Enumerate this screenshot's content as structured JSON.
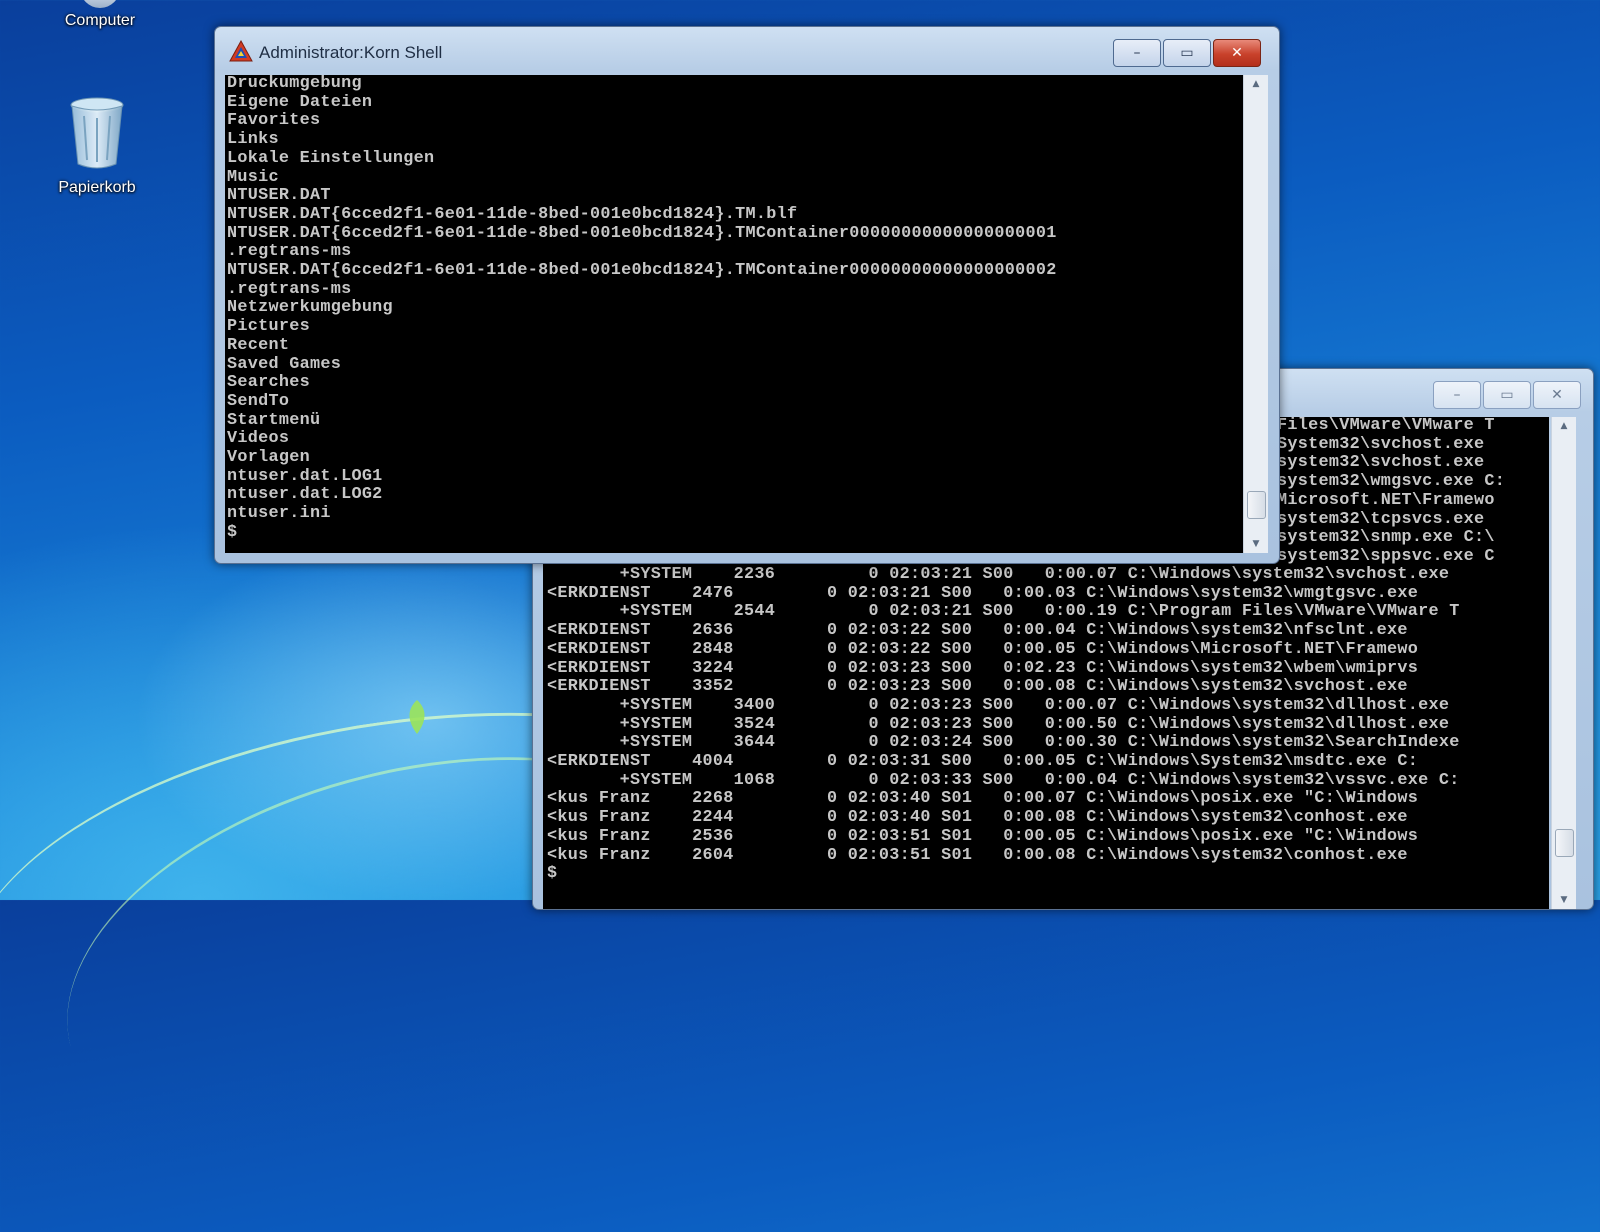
{
  "desktop": {
    "icons": [
      {
        "label": "Computer"
      },
      {
        "label": "Papierkorb"
      }
    ]
  },
  "shell_window": {
    "title": "Administrator:Korn Shell",
    "controls": {
      "minimize": "–",
      "maximize": "▭",
      "close": "✕"
    },
    "lines": [
      "Druckumgebung",
      "Eigene Dateien",
      "Favorites",
      "Links",
      "Lokale Einstellungen",
      "Music",
      "NTUSER.DAT",
      "NTUSER.DAT{6cced2f1-6e01-11de-8bed-001e0bcd1824}.TM.blf",
      "NTUSER.DAT{6cced2f1-6e01-11de-8bed-001e0bcd1824}.TMContainer00000000000000000001",
      ".regtrans-ms",
      "NTUSER.DAT{6cced2f1-6e01-11de-8bed-001e0bcd1824}.TMContainer00000000000000000002",
      ".regtrans-ms",
      "Netzwerkumgebung",
      "Pictures",
      "Recent",
      "Saved Games",
      "Searches",
      "SendTo",
      "Startmenü",
      "Videos",
      "Vorlagen",
      "ntuser.dat.LOG1",
      "ntuser.dat.LOG2",
      "ntuser.ini",
      "$"
    ]
  },
  "process_window": {
    "controls": {
      "minimize": "–",
      "maximize": "▭",
      "close": "✕"
    },
    "top_lines": [
      "Files\\VMware\\VMware T",
      "System32\\svchost.exe",
      "system32\\svchost.exe",
      "system32\\wmgsvc.exe C:",
      "Microsoft.NET\\Framewo",
      "system32\\tcpsvcs.exe",
      "system32\\snmp.exe C:\\",
      "system32\\sppsvc.exe C"
    ],
    "rows": [
      "       +SYSTEM    2236         0 02:03:21 S00   0:00.07 C:\\Windows\\system32\\svchost.exe",
      "<ERKDIENST    2476         0 02:03:21 S00   0:00.03 C:\\Windows\\system32\\wmgtgsvc.exe",
      "       +SYSTEM    2544         0 02:03:21 S00   0:00.19 C:\\Program Files\\VMware\\VMware T",
      "<ERKDIENST    2636         0 02:03:22 S00   0:00.04 C:\\Windows\\system32\\nfsclnt.exe",
      "<ERKDIENST    2848         0 02:03:22 S00   0:00.05 C:\\Windows\\Microsoft.NET\\Framewo",
      "<ERKDIENST    3224         0 02:03:23 S00   0:02.23 C:\\Windows\\system32\\wbem\\wmiprvs",
      "<ERKDIENST    3352         0 02:03:23 S00   0:00.08 C:\\Windows\\system32\\svchost.exe",
      "       +SYSTEM    3400         0 02:03:23 S00   0:00.07 C:\\Windows\\system32\\dllhost.exe",
      "       +SYSTEM    3524         0 02:03:23 S00   0:00.50 C:\\Windows\\system32\\dllhost.exe",
      "       +SYSTEM    3644         0 02:03:24 S00   0:00.30 C:\\Windows\\system32\\SearchIndexe",
      "<ERKDIENST    4004         0 02:03:31 S00   0:00.05 C:\\Windows\\System32\\msdtc.exe C:",
      "       +SYSTEM    1068         0 02:03:33 S00   0:00.04 C:\\Windows\\system32\\vssvc.exe C:",
      "<kus Franz    2268         0 02:03:40 S01   0:00.07 C:\\Windows\\posix.exe \"C:\\Windows",
      "<kus Franz    2244         0 02:03:40 S01   0:00.08 C:\\Windows\\system32\\conhost.exe",
      "<kus Franz    2536         0 02:03:51 S01   0:00.05 C:\\Windows\\posix.exe \"C:\\Windows",
      "<kus Franz    2604         0 02:03:51 S01   0:00.08 C:\\Windows\\system32\\conhost.exe",
      "$"
    ]
  }
}
